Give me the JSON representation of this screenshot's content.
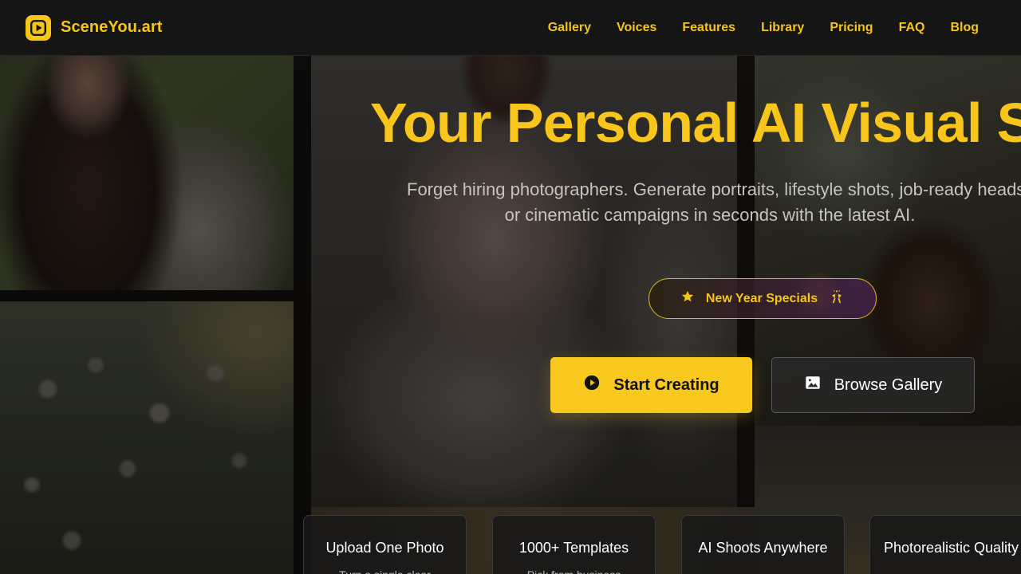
{
  "header": {
    "brand": "SceneYou.art",
    "nav": [
      "Gallery",
      "Voices",
      "Features",
      "Library",
      "Pricing",
      "FAQ",
      "Blog"
    ]
  },
  "hero": {
    "title": "Your Personal AI Visual Studio",
    "subtitle_line1": "Forget hiring photographers. Generate portraits, lifestyle shots, job-ready headshots",
    "subtitle_line2": "or cinematic campaigns in seconds with the latest AI.",
    "promo_label": "New Year Specials",
    "primary_cta": "Start Creating",
    "secondary_cta": "Browse Gallery"
  },
  "features": [
    {
      "title": "Upload One Photo",
      "desc": "Turn a single clear"
    },
    {
      "title": "1000+ Templates",
      "desc": "Pick from business"
    },
    {
      "title": "AI Shoots Anywhere",
      "desc": ""
    },
    {
      "title": "Photorealistic Quality",
      "desc": ""
    }
  ],
  "colors": {
    "accent": "#f5c518",
    "header_bg": "#151515",
    "page_bg": "#0e0d0c"
  },
  "icons": [
    "play-logo-icon",
    "star-icon",
    "party-popper-icon",
    "play-circle-icon",
    "image-icon"
  ]
}
